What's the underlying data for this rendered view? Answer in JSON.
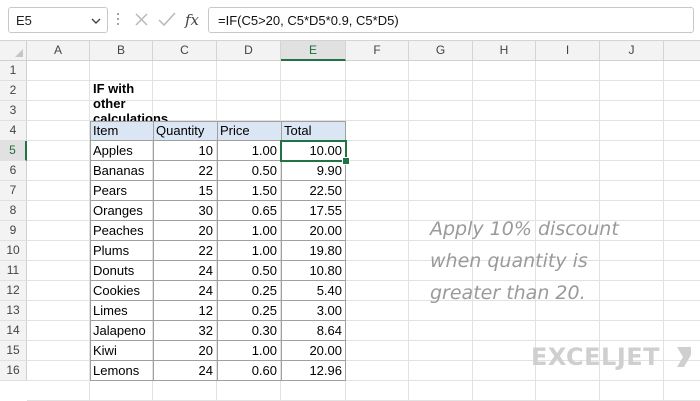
{
  "formula_bar": {
    "name_box": "E5",
    "formula": "=IF(C5>20, C5*D5*0.9, C5*D5)",
    "icons": [
      "chevron-down-icon",
      "cancel-x-icon",
      "confirm-check-icon",
      "fx-icon"
    ]
  },
  "columns": [
    "A",
    "B",
    "C",
    "D",
    "E",
    "F",
    "G",
    "H",
    "I",
    "J"
  ],
  "rows": [
    "1",
    "2",
    "3",
    "4",
    "5",
    "6",
    "7",
    "8",
    "9",
    "10",
    "11",
    "12",
    "13",
    "14",
    "15",
    "16"
  ],
  "active_cell": {
    "column": "E",
    "row": "5"
  },
  "title": "IF with other calculations",
  "table": {
    "headers": {
      "item": "Item",
      "quantity": "Quantity",
      "price": "Price",
      "total": "Total"
    },
    "rows": [
      {
        "item": "Apples",
        "quantity": "10",
        "price": "1.00",
        "total": "10.00"
      },
      {
        "item": "Bananas",
        "quantity": "22",
        "price": "0.50",
        "total": "9.90"
      },
      {
        "item": "Pears",
        "quantity": "15",
        "price": "1.50",
        "total": "22.50"
      },
      {
        "item": "Oranges",
        "quantity": "30",
        "price": "0.65",
        "total": "17.55"
      },
      {
        "item": "Peaches",
        "quantity": "20",
        "price": "1.00",
        "total": "20.00"
      },
      {
        "item": "Plums",
        "quantity": "22",
        "price": "1.00",
        "total": "19.80"
      },
      {
        "item": "Donuts",
        "quantity": "24",
        "price": "0.50",
        "total": "10.80"
      },
      {
        "item": "Cookies",
        "quantity": "24",
        "price": "0.25",
        "total": "5.40"
      },
      {
        "item": "Limes",
        "quantity": "12",
        "price": "0.25",
        "total": "3.00"
      },
      {
        "item": "Jalapeno",
        "quantity": "32",
        "price": "0.30",
        "total": "8.64"
      },
      {
        "item": "Kiwi",
        "quantity": "20",
        "price": "1.00",
        "total": "20.00"
      },
      {
        "item": "Lemons",
        "quantity": "24",
        "price": "0.60",
        "total": "12.96"
      }
    ]
  },
  "note": {
    "line1": "Apply 10% discount",
    "line2": "when quantity is",
    "line3": "greater than 20."
  },
  "logo": {
    "text": "EXCELJET"
  },
  "colors": {
    "accent": "#217346",
    "table_header": "#dbe6f4",
    "note_text": "#9a9a9a",
    "logo": "#cfcfcf"
  }
}
